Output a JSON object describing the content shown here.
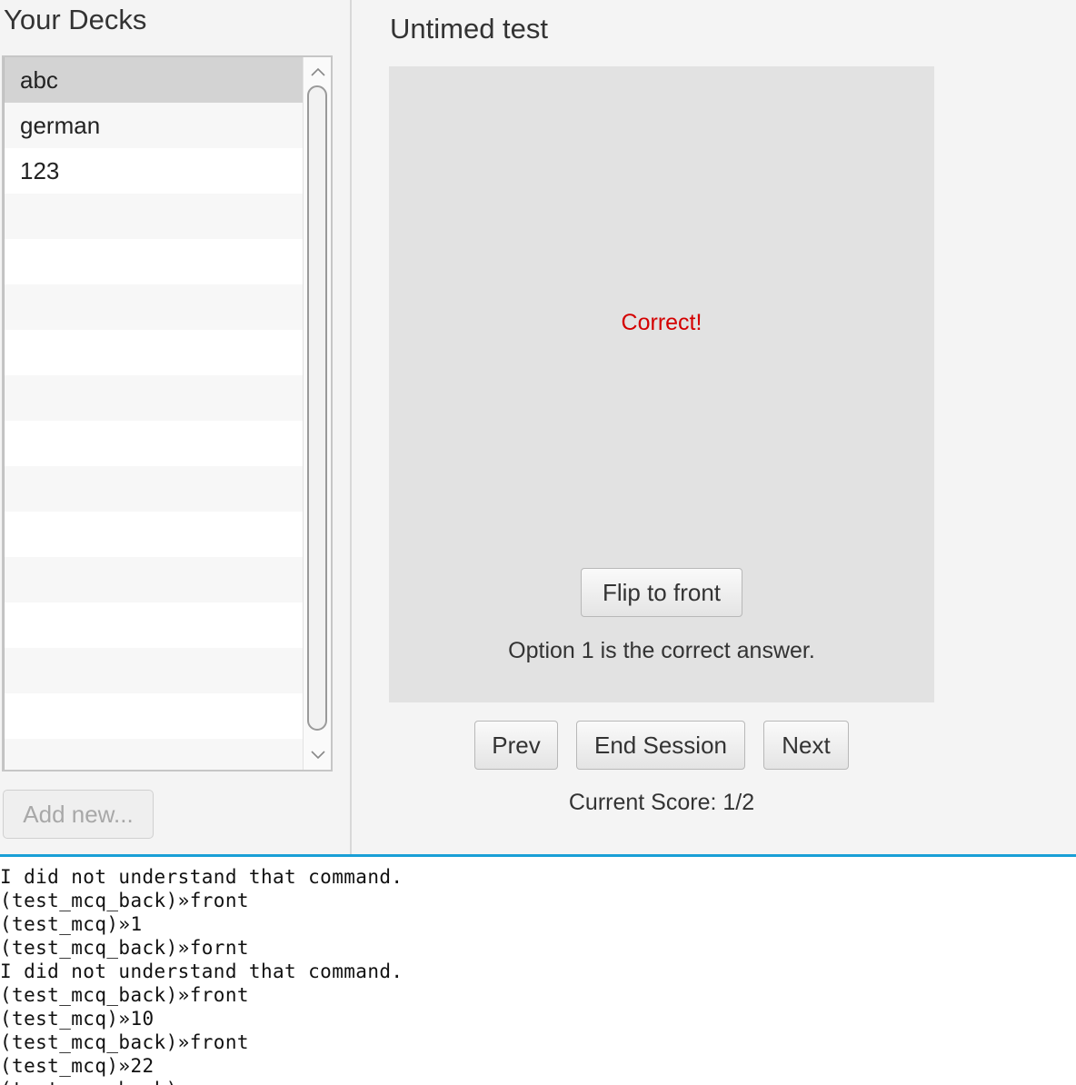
{
  "left_panel": {
    "title": "Your Decks",
    "decks": [
      "abc",
      "german",
      "123"
    ],
    "selected_deck": "abc",
    "add_new_label": "Add new..."
  },
  "test": {
    "title": "Untimed test",
    "card_message": "Correct!",
    "flip_label": "Flip to front",
    "answer_text": "Option 1 is the correct answer.",
    "prev_label": "Prev",
    "end_session_label": "End Session",
    "next_label": "Next",
    "score_text": "Current Score: 1/2"
  },
  "console": {
    "lines": [
      "I did not understand that command.",
      "(test_mcq_back)»front",
      "(test_mcq)»1",
      "(test_mcq_back)»fornt",
      "I did not understand that command.",
      "(test_mcq_back)»front",
      "(test_mcq)»10",
      "(test_mcq_back)»front",
      "(test_mcq)»22",
      "(test_mcq_back)"
    ]
  },
  "colors": {
    "correct_text": "#d40000",
    "console_border": "#1a9fd6",
    "selected_row": "#d3d3d3"
  },
  "icons": {
    "scroll_up": "chevron-up-icon",
    "scroll_down": "chevron-down-icon"
  }
}
